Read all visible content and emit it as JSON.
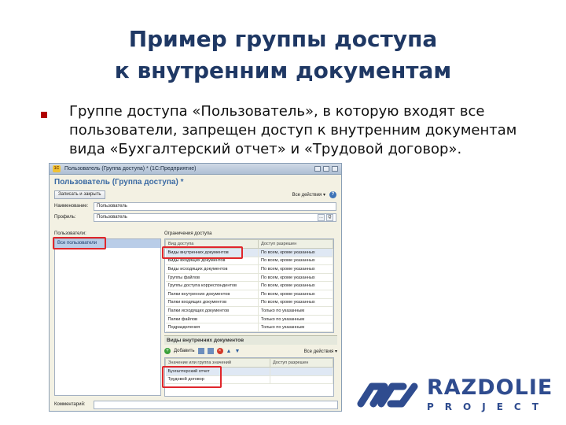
{
  "slide": {
    "title_line1": "Пример группы доступа",
    "title_line2": "к внутренним документам",
    "bullet_line1": "Группе доступа «Пользователь», в которую входят все",
    "bullet_line2": "пользователи, запрещен доступ к внутренним документам",
    "bullet_line3": "вида «Бухгалтерский отчет» и «Трудовой договор»."
  },
  "window": {
    "title": "Пользователь (Группа доступа) * (1С:Предприятие)",
    "form_title": "Пользователь (Группа доступа) *",
    "save_close_button": "Записать и закрыть",
    "actions_label": "Все действия ▾",
    "help_label": "?",
    "name_label": "Наименование:",
    "name_value": "Пользователь",
    "profile_label": "Профиль:",
    "profile_value": "Пользователь",
    "users_label": "Пользователи:",
    "users": [
      "Все пользователи"
    ],
    "access_types_label": "Ограничения доступа",
    "access_table": {
      "headers": [
        "Вид доступа",
        "Доступ разрешен"
      ],
      "rows": [
        [
          "Виды внутренних документов",
          "По всем, кроме указанных"
        ],
        [
          "Виды входящих документов",
          "По всем, кроме указанных"
        ],
        [
          "Виды исходящих документов",
          "По всем, кроме указанных"
        ],
        [
          "Группы файлов",
          "По всем, кроме указанных"
        ],
        [
          "Группы доступа корреспондентов",
          "По всем, кроме указанных"
        ],
        [
          "Папки внутренних документов",
          "По всем, кроме указанных"
        ],
        [
          "Папки входящих документов",
          "По всем, кроме указанных"
        ],
        [
          "Папки исходящих документов",
          "Только по указанным"
        ],
        [
          "Папки файлов",
          "Только по указанным"
        ],
        [
          "Подразделения",
          "Только по указанным"
        ]
      ]
    },
    "doc_types_section": "Виды внутренних документов",
    "add_button": "Добавить",
    "all_actions": "Все действия ▾",
    "doc_table": {
      "headers": [
        "Значение или группа значений",
        "Доступ разрешен"
      ],
      "rows": [
        [
          "Бухгалтерский отчет",
          ""
        ],
        [
          "Трудовой договор",
          ""
        ]
      ]
    },
    "comment_label": "Комментарий:"
  },
  "logo": {
    "name": "RAZDOLIE",
    "subtitle": "PROJECT"
  },
  "colors": {
    "title": "#1f3864",
    "bullet": "#b00000",
    "highlight": "#e0262b",
    "logo": "#2f4c8f"
  }
}
